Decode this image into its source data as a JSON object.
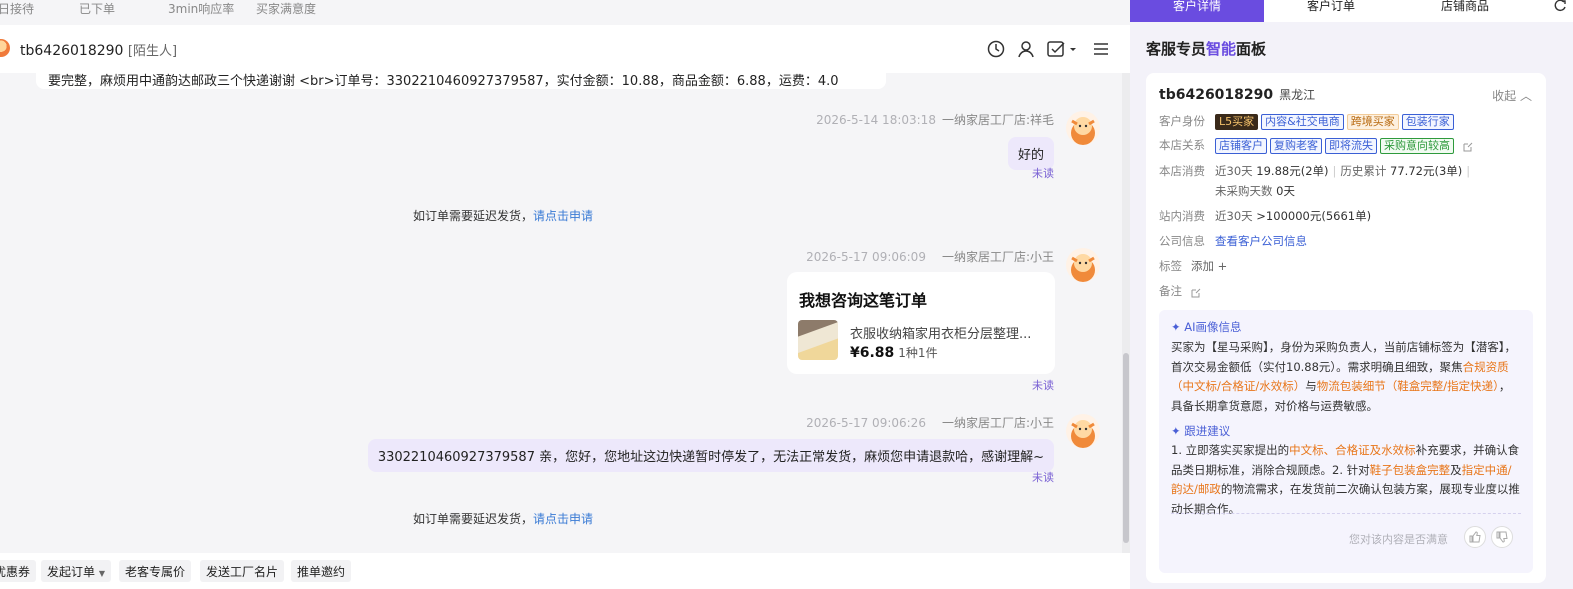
{
  "stats": [
    "日接待",
    "已下单",
    "3min响应率",
    "买家满意度"
  ],
  "header": {
    "username": "tb6426018290",
    "tag": "[陌生人]"
  },
  "chat": {
    "top_message": "要完整，麻烦用中通韵达邮政三个快递谢谢 <br>订单号：3302210460927379587，实付金额：10.88，商品金额：6.88，运费：4.0",
    "msg1": {
      "time": "2026-5-14 18:03:18",
      "shop": "一纳家居工厂店:祥毛",
      "text": "好的",
      "status": "未读"
    },
    "sys1": {
      "text": "如订单需要延迟发货，",
      "link": "请点击申请"
    },
    "msg2": {
      "time": "2026-5-17 09:06:09",
      "shop": "一纳家居工厂店:小王",
      "card_title": "我想咨询这笔订单",
      "product_name": "衣服收纳箱家用衣柜分层整理...",
      "price": "¥6.88",
      "qty": "1种1件",
      "status": "未读"
    },
    "msg3": {
      "time": "2026-5-17 09:06:26",
      "shop": "一纳家居工厂店:小王",
      "text": "3302210460927379587 亲，您好，您地址这边快递暂时停发了，无法正常发货，麻烦您申请退款哈，感谢理解~",
      "status": "未读"
    },
    "sys2": {
      "text": "如订单需要延迟发货，",
      "link": "请点击申请"
    }
  },
  "quick_actions": [
    "优惠券",
    "发起订单",
    "老客专属价",
    "发送工厂名片",
    "推单邀约"
  ],
  "panel": {
    "tabs": [
      "客户详情",
      "客户订单",
      "店铺商品"
    ],
    "title_pre": "客服专员",
    "title_hl": "智能",
    "title_post": "面板",
    "user": {
      "name": "tb6426018290",
      "location": "黑龙江",
      "collapse": "收起"
    },
    "identity_label": "客户身份",
    "identity_tags": [
      "L5买家",
      "内容&社交电商",
      "跨境买家",
      "包装行家"
    ],
    "relation_label": "本店关系",
    "relation_tags": [
      "店铺客户",
      "复购老客",
      "即将流失",
      "采购意向较高"
    ],
    "consume_label": "本店消费",
    "consume_30": "近30天",
    "consume_30_val": "19.88元(2单)",
    "consume_hist": "历史累计",
    "consume_hist_val": "77.72元(3单)",
    "no_buy": "未采购天数",
    "no_buy_val": "0天",
    "site_label": "站内消费",
    "site_30": "近30天",
    "site_val": ">100000元(5661单)",
    "company_label": "公司信息",
    "company_link": "查看客户公司信息",
    "tag_label": "标签",
    "tag_add": "添加 +",
    "note_label": "备注",
    "ai_portrait_title": "AI画像信息",
    "ai_portrait": {
      "p1": "买家为【星马采购】，身份为采购负责人，当前店铺标签为【潜客】，首次交易金额低（实付10.88元）。需求明确且细致，聚焦",
      "hl1": "合规资质（中文标/合格证/水效标）",
      "p2": "与",
      "hl2": "物流包装细节（鞋盒完整/指定快递）",
      "p3": "，具备长期拿货意愿，对价格与运费敏感。"
    },
    "followup_title": "跟进建议",
    "followup": {
      "p1": "1. 立即落实买家提出的",
      "hl1": "中文标、合格证及水效标",
      "p2": "补充要求，并确认食品类日期标准，消除合规顾虑。2. 针对",
      "hl2": "鞋子包装盒完整",
      "p3": "及",
      "hl3": "指定中通/韵达/邮政",
      "p4": "的物流需求，在发货前二次确认包装方案，展现专业度以推动长期合作。"
    },
    "feedback": "您对该内容是否满意"
  }
}
